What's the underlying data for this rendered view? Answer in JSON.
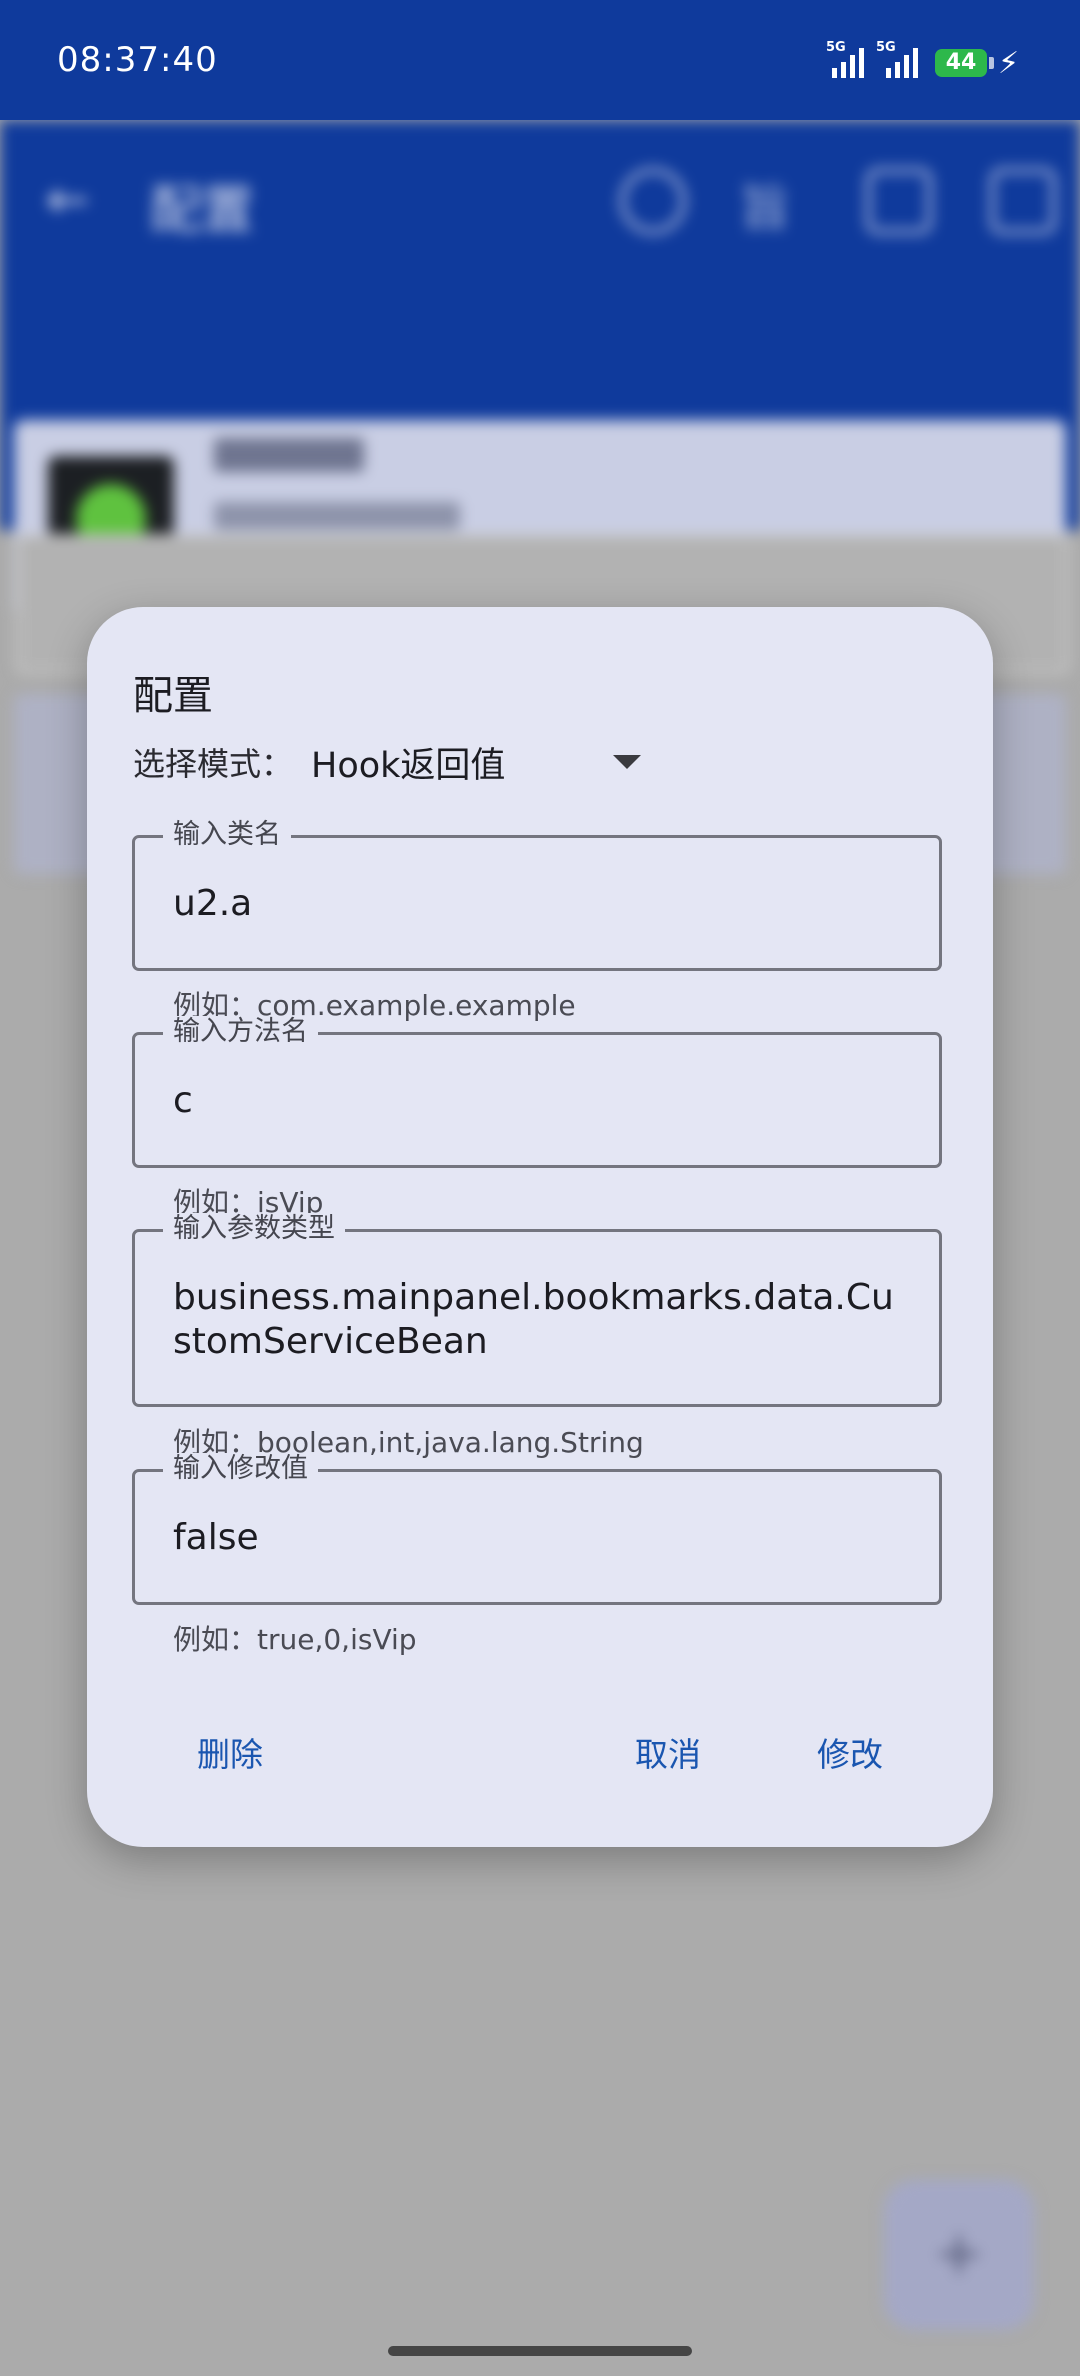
{
  "status_bar": {
    "time": "08:37:40",
    "signal_1_label": "5G",
    "signal_2_label": "5G",
    "battery_level": "44",
    "charging_icon": "bolt-icon"
  },
  "dialog": {
    "title": "配置",
    "mode_label": "选择模式：",
    "mode_value": "Hook返回值",
    "fields": [
      {
        "label": "输入类名",
        "value": "u2.a",
        "hint": "例如：com.example.example"
      },
      {
        "label": "输入方法名",
        "value": "c",
        "hint": "例如：isVip"
      },
      {
        "label": "输入参数类型",
        "value": "business.mainpanel.bookmarks.data.CustomServiceBean",
        "hint": "例如：boolean,int,java.lang.String"
      },
      {
        "label": "输入修改值",
        "value": "false",
        "hint": "例如：true,0,isVip"
      }
    ],
    "buttons": {
      "delete": "删除",
      "cancel": "取消",
      "modify": "修改"
    }
  },
  "colors": {
    "app_bar": "#0f3a9c",
    "dialog_bg": "#e4e6f4",
    "accent": "#1a56b0",
    "battery": "#2db84b"
  }
}
